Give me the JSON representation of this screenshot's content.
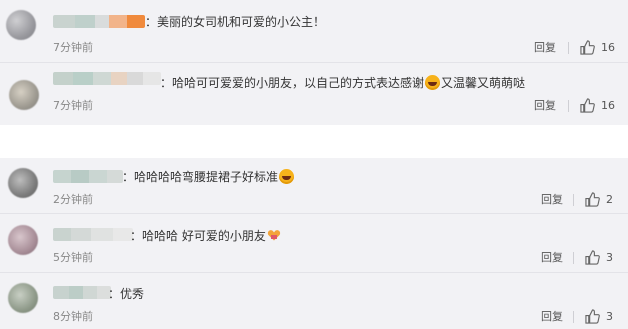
{
  "comments": [
    {
      "text": "：美丽的女司机和可爱的小公主！",
      "time": "7分钟前",
      "reply_label": "回复",
      "likes": "16"
    },
    {
      "text_before_emoji": "：哈哈可可爱爱的小朋友，以自己的方式表达感谢",
      "text_after_emoji": "又温馨又萌萌哒",
      "time": "7分钟前",
      "reply_label": "回复",
      "likes": "16"
    },
    {
      "text_before_emoji": "：哈哈哈哈弯腰提裙子好标准",
      "time": "2分钟前",
      "reply_label": "回复",
      "likes": "2"
    },
    {
      "text_before_emoji": "：哈哈哈 好可爱的小朋友",
      "time": "5分钟前",
      "reply_label": "回复",
      "likes": "3"
    },
    {
      "text": "：优秀",
      "time": "8分钟前",
      "reply_label": "回复",
      "likes": "3"
    }
  ],
  "icons": {
    "like": "thumbs-up-icon",
    "laugh": "laughing-emoji-icon",
    "heart": "heart-gift-emoji-icon"
  },
  "colors": {
    "panel_bg": "#f2f2f5",
    "text": "#333333",
    "muted": "#888888"
  }
}
